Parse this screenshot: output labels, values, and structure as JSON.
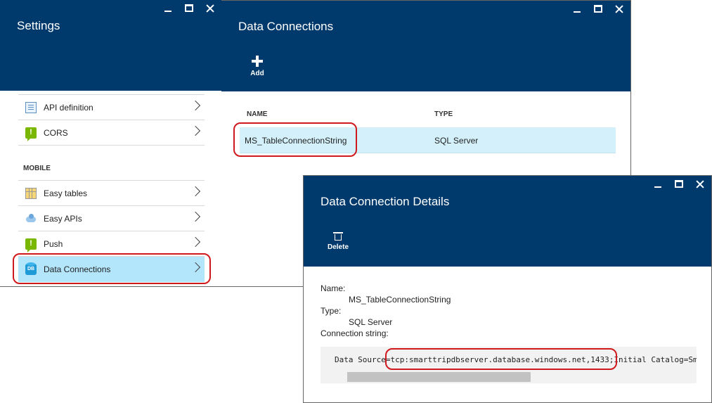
{
  "settings": {
    "title": "Settings",
    "items": [
      {
        "label": "API definition",
        "icon": "api-definition-icon"
      },
      {
        "label": "CORS",
        "icon": "cors-icon"
      }
    ],
    "section": "MOBILE",
    "mobile_items": [
      {
        "label": "Easy tables",
        "icon": "easy-tables-icon"
      },
      {
        "label": "Easy APIs",
        "icon": "easy-apis-icon"
      },
      {
        "label": "Push",
        "icon": "push-icon"
      },
      {
        "label": "Data Connections",
        "icon": "database-icon",
        "selected": true
      }
    ]
  },
  "connections": {
    "title": "Data Connections",
    "add_label": "Add",
    "columns": [
      "NAME",
      "TYPE"
    ],
    "rows": [
      {
        "name": "MS_TableConnectionString",
        "type": "SQL Server"
      }
    ]
  },
  "details": {
    "title": "Data Connection Details",
    "delete_label": "Delete",
    "name_label": "Name:",
    "name_value": "MS_TableConnectionString",
    "type_label": "Type:",
    "type_value": "SQL Server",
    "conn_label": "Connection string:",
    "conn_value": "Data Source=tcp:smarttripdbserver.database.windows.net,1433;Initial Catalog=Sm"
  },
  "colors": {
    "header_bg": "#003a6c",
    "selected_bg": "#b3e6fb",
    "row_bg": "#d4f1fb",
    "highlight": "#d0191c"
  }
}
